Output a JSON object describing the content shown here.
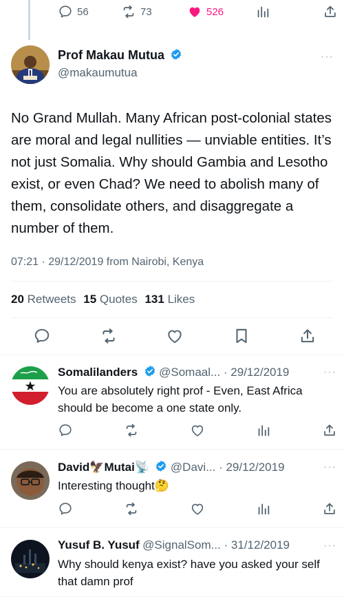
{
  "top_bar": {
    "replies": "56",
    "retweets": "73",
    "likes": "526"
  },
  "tweet": {
    "name": "Prof Makau Mutua",
    "handle": "@makaumutua",
    "more": "···",
    "text": "No Grand Mullah.  Many African post-colonial states are moral and legal nullities — unviable entities.  It’s not just Somalia.  Why should Gambia and Lesotho exist, or even Chad?  We need to abolish many of them, consolidate others, and disaggregate a number of them.",
    "timestamp": "07:21 · 29/12/2019 from Nairobi, Kenya",
    "stats": {
      "retweets_count": "20",
      "retweets_label": "Retweets",
      "quotes_count": "15",
      "quotes_label": "Quotes",
      "likes_count": "131",
      "likes_label": "Likes"
    }
  },
  "replies": [
    {
      "name": "Somalilanders",
      "handle_date": "@Somaal... · 29/12/2019",
      "text": "You are absolutely right prof - Even, East Africa should be become a one state only.",
      "verified": true
    },
    {
      "name": "David🦅Mutai📡",
      "handle_date": "@Davi... · 29/12/2019",
      "text": "Interesting thought🤔",
      "verified": true
    },
    {
      "name": "Yusuf B. Yusuf",
      "handle_date": "@SignalSom... · 31/12/2019",
      "text": "Why should kenya exist? have you asked your self that damn prof",
      "verified": false
    }
  ],
  "colors": {
    "accent": "#1d9bf0",
    "like_pink": "#f91880",
    "text": "#0f1419",
    "secondary": "#536471"
  }
}
